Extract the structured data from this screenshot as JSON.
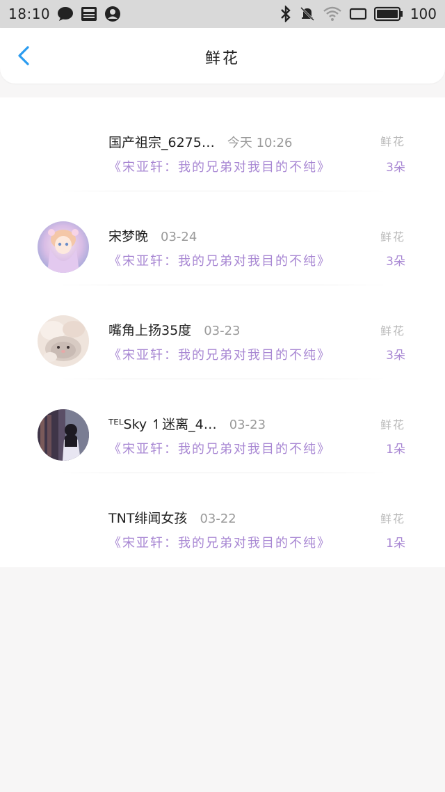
{
  "status_bar": {
    "time": "18:10",
    "battery": "100",
    "left_icons": [
      "chat-bubble-icon",
      "news-icon",
      "account-icon"
    ],
    "right_icons": [
      "bluetooth-icon",
      "mute-bell-icon",
      "wifi-icon",
      "screen-icon",
      "battery-icon"
    ]
  },
  "header": {
    "title": "鲜花",
    "back_icon": "chevron-left-icon",
    "accent_color": "#2a9cf0"
  },
  "list": {
    "song_color": "#a887d3",
    "items": [
      {
        "name": "国产祖宗_6275…",
        "time": "今天 10:26",
        "gift": "鲜花",
        "song": "《宋亚轩：我的兄弟对我目的不纯》",
        "count": "3朵",
        "avatar": "none"
      },
      {
        "name": "宋梦晚",
        "time": "03-24",
        "gift": "鲜花",
        "song": "《宋亚轩：我的兄弟对我目的不纯》",
        "count": "3朵",
        "avatar": "anime-girl-avatar"
      },
      {
        "name": "嘴角上扬35度",
        "time": "03-23",
        "gift": "鲜花",
        "song": "《宋亚轩：我的兄弟对我目的不纯》",
        "count": "3朵",
        "avatar": "hamster-avatar"
      },
      {
        "name": "ᵀᴱᴸSky ↿迷离_4…",
        "time": "03-23",
        "gift": "鲜花",
        "song": "《宋亚轩：我的兄弟对我目的不纯》",
        "count": "1朵",
        "avatar": "girl-photo-avatar"
      },
      {
        "name": "TNT绯闻女孩",
        "time": "03-22",
        "gift": "鲜花",
        "song": "《宋亚轩：我的兄弟对我目的不纯》",
        "count": "1朵",
        "avatar": "none"
      }
    ]
  }
}
